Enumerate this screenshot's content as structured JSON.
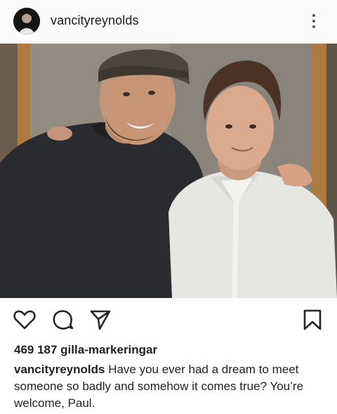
{
  "post": {
    "username": "vancityreynolds",
    "likes_text": "469 187 gilla-markeringar",
    "caption_user": "vancityreynolds",
    "caption_text": "Have you ever had a dream to meet someone so badly and somehow it comes true? You’re welcome, Paul."
  },
  "icons": {
    "more": "more-vertical-icon",
    "like": "heart-icon",
    "comment": "comment-icon",
    "share": "send-icon",
    "save": "bookmark-icon"
  },
  "colors": {
    "text": "#262626",
    "header_bg": "#fbfbfb"
  }
}
